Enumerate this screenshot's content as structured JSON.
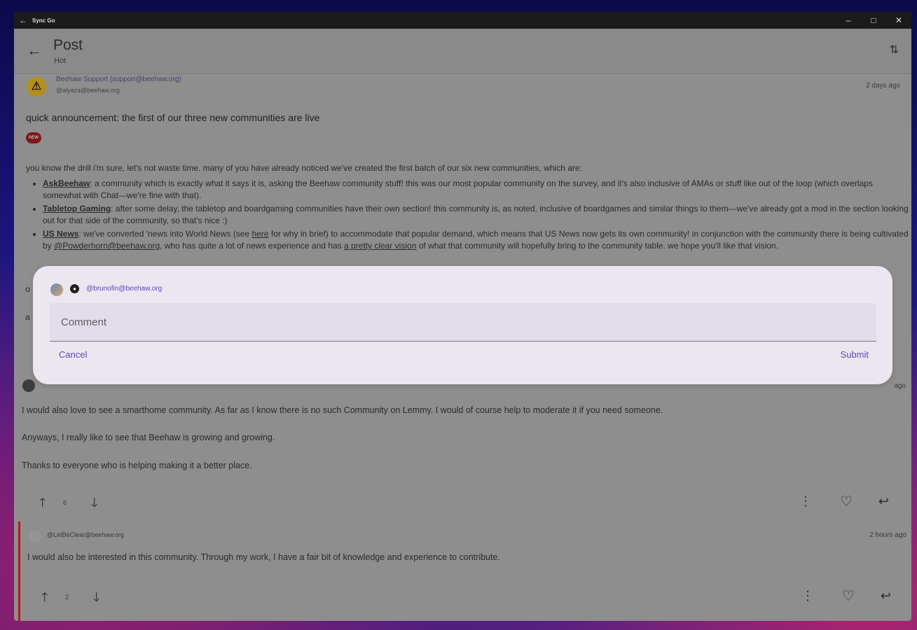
{
  "window": {
    "title": "Sync Go",
    "back": "←",
    "minimize": "–",
    "maximize": "□",
    "close": "✕"
  },
  "appbar": {
    "title": "Post",
    "subtitle": "Hot"
  },
  "post": {
    "author_name": "Beehaw Support (support@beehaw.org)",
    "author_handle": "@alyaza@beehaw.org",
    "time": "2 days ago",
    "title": "quick announcement: the first of our three new communities are live",
    "badge": "NEW",
    "intro": "you know the drill i'm sure, let's not waste time. many of you have already noticed we've created the first batch of our six new communities, which are:",
    "bullets": [
      {
        "name": "AskBeehaw",
        "text": ": a community which is exactly what it says it is, asking the Beehaw community stuff! this was our most popular community on the survey, and it's also inclusive of AMAs or stuff like out of the loop (which overlaps somewhat with Chat—we're fine with that)."
      },
      {
        "name": "Tabletop Gaming",
        "text": ": after some delay, the tabletop and boardgaming communities have their own section! this community is, as noted, inclusive of boardgames and similar things to them—we've already got a mod in the section looking out for that side of the community, so that's nice :)"
      },
      {
        "name": "US News",
        "text_a": ": we've converted 'news into World News (see ",
        "link1": "here",
        "text_b": " for why in brief) to accommodate that popular demand, which means that US News now gets its own community! in conjunction with the community there is being cultivated by ",
        "link2": "@Powderhorn@beehaw.org",
        "text_c": ", who has quite a lot of news experience and has ",
        "link3": "a pretty clear vision",
        "text_d": " of what that community will hopefully bring to the community table. we hope you'll like that vision."
      }
    ],
    "hidden_line_1": "o",
    "hidden_line_2": "a"
  },
  "comment1": {
    "time_clipped": "ago",
    "paragraphs": [
      "I would also love to see a smarthome community. As far as I know there is no such Community on Lemmy. I would of course help to moderate it if you need someone.",
      "Anyways, I really like to see that Beehaw is growing and growing.",
      "Thanks to everyone who is helping making it a better place."
    ],
    "score": "6"
  },
  "comment2": {
    "handle": "@LetBeClear@beehaw.org",
    "time": "2 hours ago",
    "body": "I would also be interested in this community. Through my work, I have a fair bit of knowledge and experience to contribute.",
    "score": "2"
  },
  "dialog": {
    "handle": "@brunofin@beehaw.org",
    "placeholder": "Comment",
    "cancel": "Cancel",
    "submit": "Submit"
  },
  "icons": {
    "up": "🡑",
    "down": "🡓",
    "more": "⋮",
    "heart": "♡",
    "reply": "↩",
    "sort": "⇅",
    "person": "●",
    "warning": "⚠"
  }
}
